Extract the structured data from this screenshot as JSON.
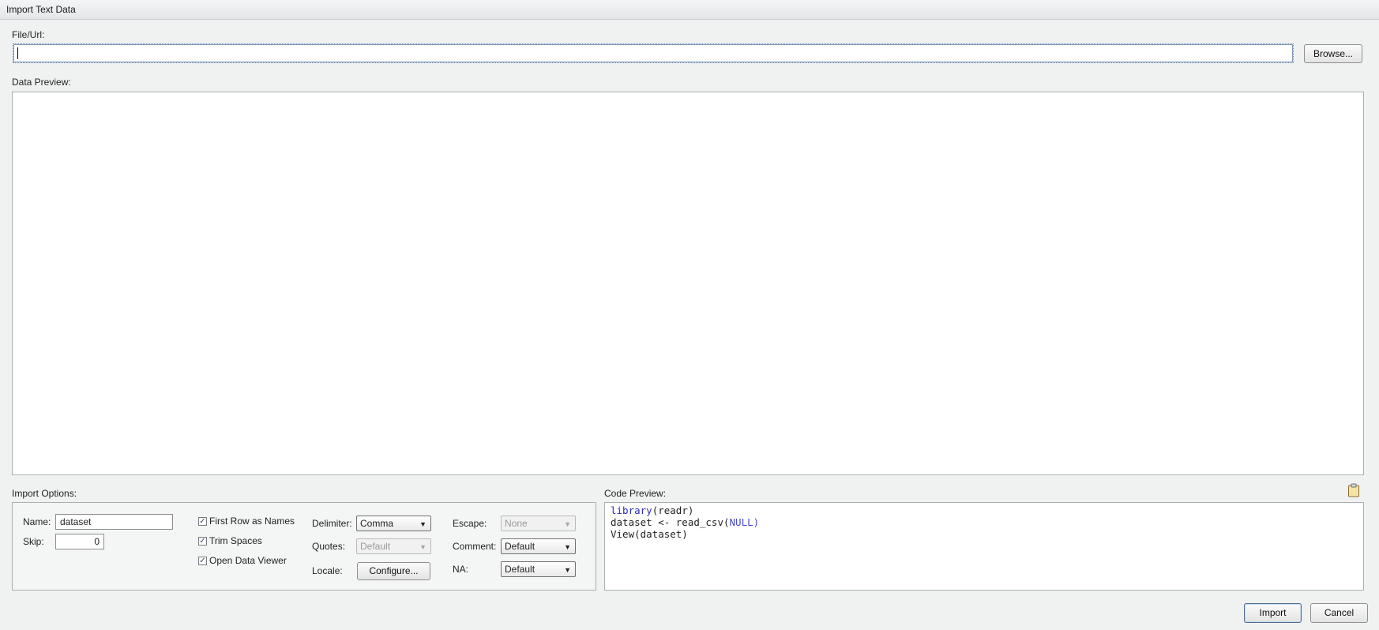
{
  "window": {
    "title": "Import Text Data"
  },
  "file": {
    "label": "File/Url:",
    "value": "",
    "browse_label": "Browse..."
  },
  "preview": {
    "label": "Data Preview:"
  },
  "options": {
    "label": "Import Options:",
    "name_label": "Name:",
    "name_value": "dataset",
    "skip_label": "Skip:",
    "skip_value": "0",
    "first_row": {
      "label": "First Row as Names",
      "checked": true
    },
    "trim_spaces": {
      "label": "Trim Spaces",
      "checked": true
    },
    "open_viewer": {
      "label": "Open Data Viewer",
      "checked": true
    },
    "delimiter": {
      "label": "Delimiter:",
      "value": "Comma"
    },
    "quotes": {
      "label": "Quotes:",
      "value": "Default"
    },
    "locale": {
      "label": "Locale:",
      "button": "Configure..."
    },
    "escape": {
      "label": "Escape:",
      "value": "None"
    },
    "comment": {
      "label": "Comment:",
      "value": "Default"
    },
    "na": {
      "label": "NA:",
      "value": "Default"
    }
  },
  "code": {
    "label": "Code Preview:",
    "line1": {
      "fn": "library",
      "arg": "(readr)"
    },
    "line2": {
      "pre": "dataset <- read_csv(",
      "const": "NULL",
      "post": ")"
    },
    "line3": "View(dataset)"
  },
  "actions": {
    "import_label": "Import",
    "cancel_label": "Cancel"
  },
  "colors": {
    "accent": "#7f9db9",
    "keyword": "#2b2bb8",
    "constant": "#4a4ad6"
  }
}
